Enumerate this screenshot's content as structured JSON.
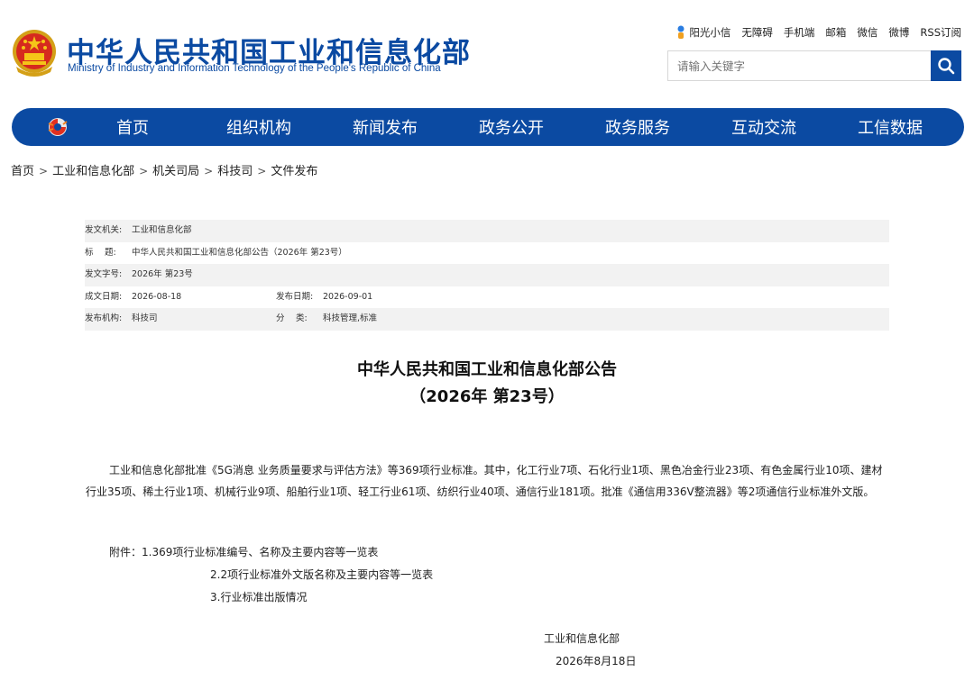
{
  "header": {
    "title": "中华人民共和国工业和信息化部",
    "subtitle": "Ministry of Industry and Information Technology of the People's Republic of China",
    "top_links": [
      "阳光小信",
      "无障碍",
      "手机端",
      "邮箱",
      "微信",
      "微博",
      "RSS订阅"
    ],
    "search_placeholder": "请输入关键字"
  },
  "nav": {
    "items": [
      "首页",
      "组织机构",
      "新闻发布",
      "政务公开",
      "政务服务",
      "互动交流",
      "工信数据"
    ]
  },
  "breadcrumb": [
    "首页",
    "工业和信息化部",
    "机关司局",
    "科技司",
    "文件发布"
  ],
  "meta": {
    "issuer_label": "发文机关:",
    "issuer": "工业和信息化部",
    "title_label": "标　 题:",
    "title": "中华人民共和国工业和信息化部公告（2026年 第23号）",
    "doc_no_label": "发文字号:",
    "doc_no": "2026年 第23号",
    "created_label": "成文日期:",
    "created": "2026-08-18",
    "published_label": "发布日期:",
    "published": "2026-09-01",
    "org_label": "发布机构:",
    "org": "科技司",
    "category_label": "分　 类:",
    "category": "科技管理,标准"
  },
  "document": {
    "title_line1": "中华人民共和国工业和信息化部公告",
    "title_line2": "（2026年 第23号）",
    "paragraph": "工业和信息化部批准《5G消息 业务质量要求与评估方法》等369项行业标准。其中，化工行业7项、石化行业1项、黑色冶金行业23项、有色金属行业10项、建材行业35项、稀土行业1项、机械行业9项、船舶行业1项、轻工行业61项、纺织行业40项、通信行业181项。批准《通信用336V整流器》等2项通信行业标准外文版。",
    "attachment_label": "附件：",
    "attachments": [
      "1.369项行业标准编号、名称及主要内容等一览表",
      "2.2项行业标准外文版名称及主要内容等一览表",
      "3.行业标准出版情况"
    ],
    "signer": "工业和信息化部",
    "sign_date": "2026年8月18日"
  },
  "colors": {
    "brand_blue": "#0b4aa2",
    "meta_shade": "#f2f2f2"
  }
}
